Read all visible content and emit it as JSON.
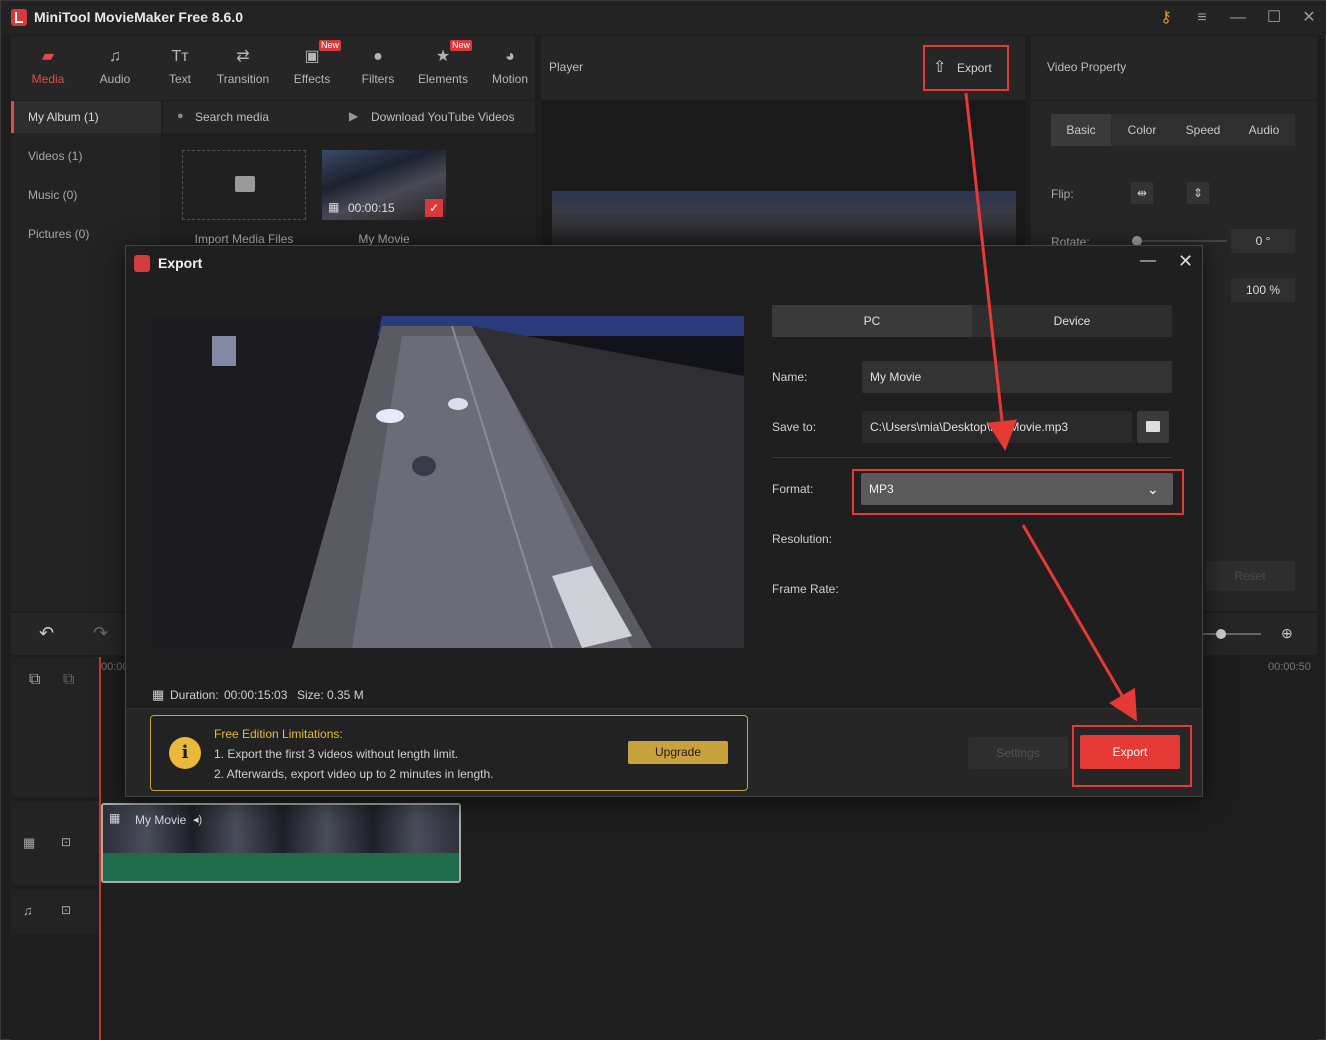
{
  "app": {
    "title": "MiniTool MovieMaker Free 8.6.0"
  },
  "toolbar": {
    "items": [
      {
        "label": "Media",
        "icon": "folder-icon"
      },
      {
        "label": "Audio",
        "icon": "music-note-icon"
      },
      {
        "label": "Text",
        "icon": "text-icon"
      },
      {
        "label": "Transition",
        "icon": "transition-icon"
      },
      {
        "label": "Effects",
        "icon": "effects-icon",
        "badge": "New"
      },
      {
        "label": "Filters",
        "icon": "filters-icon"
      },
      {
        "label": "Elements",
        "icon": "elements-icon",
        "badge": "New"
      },
      {
        "label": "Motion",
        "icon": "motion-icon"
      }
    ]
  },
  "sidebar": {
    "items": [
      {
        "label": "My Album (1)"
      },
      {
        "label": "Videos (1)"
      },
      {
        "label": "Music (0)"
      },
      {
        "label": "Pictures (0)"
      }
    ]
  },
  "media": {
    "search_placeholder": "Search media",
    "download_label": "Download YouTube Videos",
    "import_label": "Import Media Files",
    "clip_label": "My Movie",
    "clip_duration": "00:00:15"
  },
  "player": {
    "title": "Player",
    "export_label": "Export"
  },
  "property": {
    "title": "Video Property",
    "tabs": [
      "Basic",
      "Color",
      "Speed",
      "Audio"
    ],
    "flip_label": "Flip:",
    "rotate_label": "Rotate:",
    "rotate_value": "0 °",
    "scale_value": "100 %",
    "reset_label": "Reset"
  },
  "timeline": {
    "start_time": "00:00",
    "end_time": "00:00:50",
    "clip_label": "My Movie"
  },
  "export_dialog": {
    "title": "Export",
    "tabs": {
      "pc": "PC",
      "device": "Device"
    },
    "name_label": "Name:",
    "name_value": "My Movie",
    "save_label": "Save to:",
    "save_value": "C:\\Users\\mia\\Desktop\\My Movie.mp3",
    "format_label": "Format:",
    "format_value": "MP3",
    "resolution_label": "Resolution:",
    "framerate_label": "Frame Rate:",
    "duration_label": "Duration:",
    "duration_value": "00:00:15:03",
    "size_label": "Size:",
    "size_value": "0.35 M",
    "limit_title": "Free Edition Limitations:",
    "limit_line1": "1. Export the first 3 videos without length limit.",
    "limit_line2": "2. Afterwards, export video up to 2 minutes in length.",
    "upgrade_label": "Upgrade",
    "settings_label": "Settings",
    "export_label": "Export"
  },
  "colors": {
    "accent": "#e04b4b",
    "export_red": "#e53935",
    "upgrade_gold": "#c9a23d"
  }
}
